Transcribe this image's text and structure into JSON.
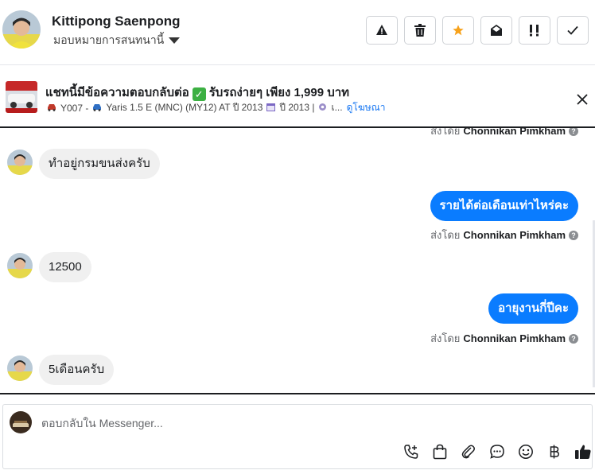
{
  "header": {
    "contact_name": "Kittipong Saenpong",
    "assign_label": "มอบหมายการสนทนานี้",
    "actions": [
      {
        "icon": "warning-icon"
      },
      {
        "icon": "trash-icon"
      },
      {
        "icon": "star-icon",
        "color": "#f7a21b"
      },
      {
        "icon": "envelope-open-icon"
      },
      {
        "icon": "important-icon"
      },
      {
        "icon": "check-icon"
      }
    ]
  },
  "ad": {
    "title_part1": "แชทนี้มีข้อความตอบกลับต่อ",
    "title_part2": "รับรถง่ายๆ เพียง 1,999 บาท",
    "sub_id": "Y007 -",
    "sub_model": "Yaris 1.5 E (MNC) (MY12) AT ปี 2013",
    "sub_year": "ปี 2013 |",
    "sub_more": "เ...",
    "link": "ดูโฆษณา"
  },
  "chat": {
    "top_sentby_prefix": "ส่งโดย",
    "top_sentby_name": "Chonnikan Pimkham",
    "messages": [
      {
        "dir": "in",
        "text": "ทำอยู่กรมขนส่งครับ"
      },
      {
        "dir": "out",
        "text": "รายได้ต่อเดือนเท่าไหร่คะ",
        "sentby_prefix": "ส่งโดย",
        "sentby_name": "Chonnikan Pimkham"
      },
      {
        "dir": "in",
        "text": "12500"
      },
      {
        "dir": "out",
        "text": "อายุงานกี่ปีคะ",
        "sentby_prefix": "ส่งโดย",
        "sentby_name": "Chonnikan Pimkham"
      },
      {
        "dir": "in",
        "text": "5เดือนครับ"
      }
    ]
  },
  "composer": {
    "placeholder": "ตอบกลับใน Messenger..."
  },
  "colors": {
    "accent": "#0a7cff",
    "link": "#1877f2",
    "star": "#f7a21b",
    "incoming_bubble": "#f0f0f0"
  }
}
